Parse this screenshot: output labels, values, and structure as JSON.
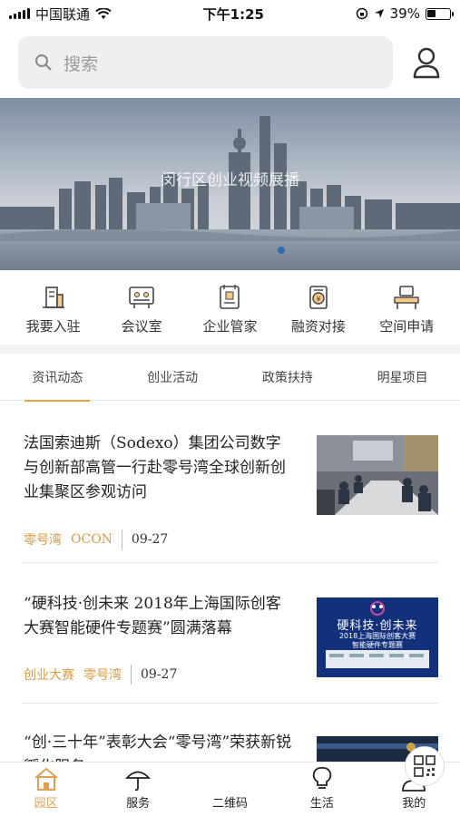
{
  "status_bar": {
    "carrier": "中国联通",
    "time": "下午1:25",
    "battery": "39%",
    "battery_level": 0.39
  },
  "search": {
    "placeholder": "搜索"
  },
  "banner": {
    "caption": "闵行区创业视频展播"
  },
  "quick_menu": [
    {
      "label": "我要入驻",
      "icon": "building-icon"
    },
    {
      "label": "会议室",
      "icon": "meeting-room-icon"
    },
    {
      "label": "企业管家",
      "icon": "butler-icon"
    },
    {
      "label": "融资对接",
      "icon": "finance-icon"
    },
    {
      "label": "空间申请",
      "icon": "workspace-icon"
    }
  ],
  "tabs": [
    {
      "label": "资讯动态",
      "active": true
    },
    {
      "label": "创业活动",
      "active": false
    },
    {
      "label": "政策扶持",
      "active": false
    },
    {
      "label": "明星项目",
      "active": false
    }
  ],
  "news": [
    {
      "title": "法国索迪斯（Sodexo）集团公司数字与创新部高管一行赴零号湾全球创新创业集聚区参观访问",
      "tags": [
        "零号湾",
        "OCON"
      ],
      "date": "09-27"
    },
    {
      "title": "“硬科技·创未来 2018年上海国际创客大赛智能硬件专题赛”圆满落幕",
      "tags": [
        "创业大赛",
        "零号湾"
      ],
      "date": "09-27",
      "thumb_text": [
        "硬科技·创未来",
        "2018上海国际创客大赛",
        "智能硬件专题赛"
      ]
    },
    {
      "title": "“创·三十年”表彰大会“零号湾”荣获新锐孵化服务",
      "tags": [],
      "date": ""
    }
  ],
  "tabbar": [
    {
      "label": "园区",
      "icon": "home-icon",
      "active": true
    },
    {
      "label": "服务",
      "icon": "umbrella-icon",
      "active": false
    },
    {
      "label": "二维码",
      "icon": "qr-code-icon",
      "active": false
    },
    {
      "label": "生活",
      "icon": "bulb-icon",
      "active": false
    },
    {
      "label": "我的",
      "icon": "user-icon",
      "active": false
    }
  ],
  "colors": {
    "accent": "#e0a050",
    "tag": "#d99a45"
  }
}
